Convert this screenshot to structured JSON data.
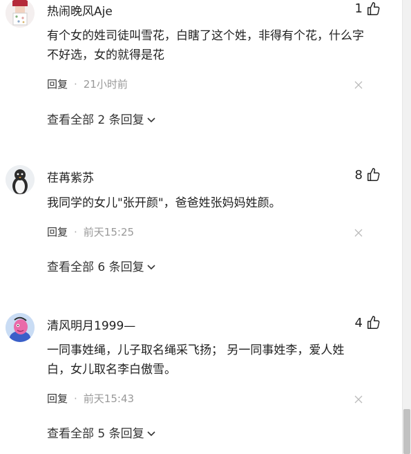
{
  "comments": [
    {
      "username": "热闹晚风Aje",
      "likes": "1",
      "text": "有个女的姓司徒叫雪花，白瞎了这个姓，非得有个花，什么字不好选，女的就得是花",
      "reply_label": "回复",
      "separator": "·",
      "time": "21小时前",
      "view_all": "查看全部 2 条回复"
    },
    {
      "username": "荏苒紫苏",
      "likes": "8",
      "text": "我同学的女儿\"张开颜\"，爸爸姓张妈妈姓颜。",
      "reply_label": "回复",
      "separator": "·",
      "time": "前天15:25",
      "view_all": "查看全部 6 条回复"
    },
    {
      "username": "清风明月1999—",
      "likes": "4",
      "text": "一同事姓绳，儿子取名绳采飞扬； 另一同事姓李，爱人姓白，女儿取名李白傲雪。",
      "reply_label": "回复",
      "separator": "·",
      "time": "前天15:43",
      "view_all": "查看全部 5 条回复"
    }
  ],
  "icons": {
    "like": "thumbs-up-icon",
    "close": "close-icon",
    "expand": "chevron-down-icon"
  },
  "colors": {
    "text": "#222222",
    "meta": "#999999",
    "close": "#bbbbbb"
  }
}
